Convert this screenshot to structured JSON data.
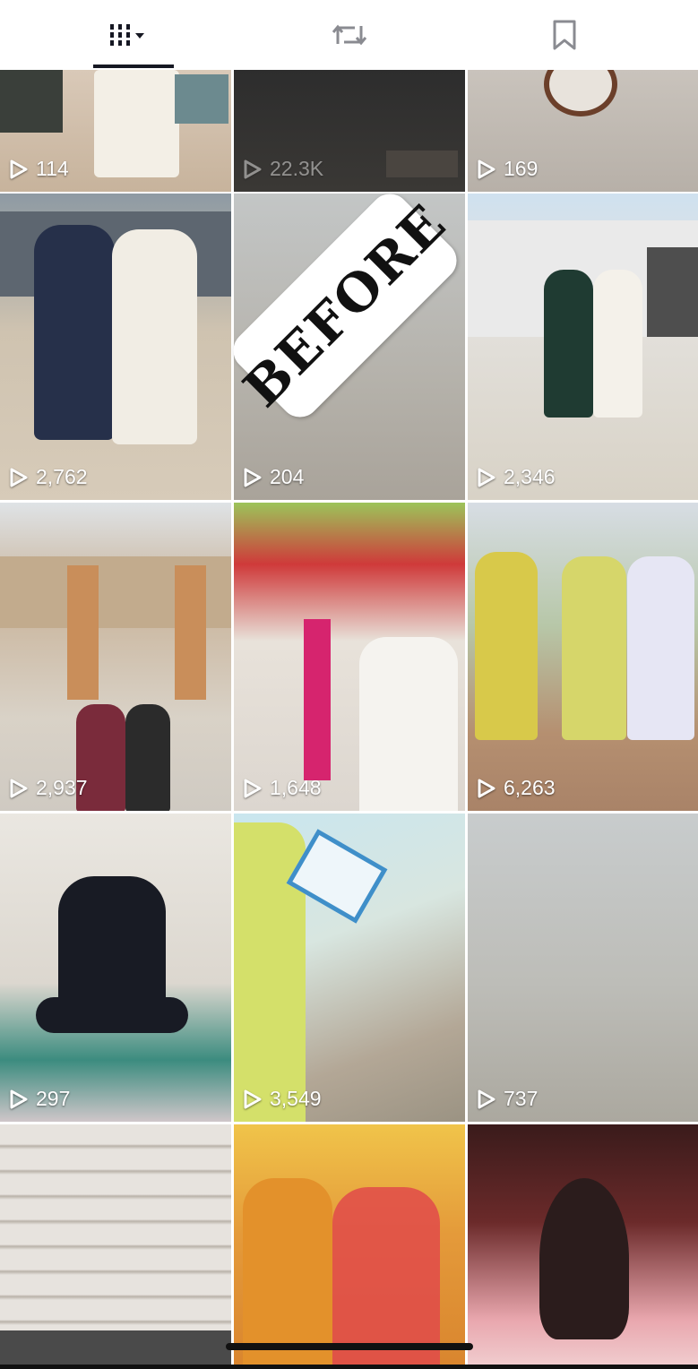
{
  "tabs": [
    {
      "name": "videos-grid-icon",
      "active": true
    },
    {
      "name": "repost-icon",
      "active": false
    },
    {
      "name": "bookmark-icon",
      "active": false
    }
  ],
  "sticker": {
    "text": "BEFORE"
  },
  "videos": [
    {
      "views": "114"
    },
    {
      "views": "22.3K"
    },
    {
      "views": "169"
    },
    {
      "views": "2,762"
    },
    {
      "views": "204"
    },
    {
      "views": "2,346"
    },
    {
      "views": "2,937"
    },
    {
      "views": "1,648"
    },
    {
      "views": "6,263"
    },
    {
      "views": "297"
    },
    {
      "views": "3,549"
    },
    {
      "views": "737"
    },
    {
      "views": ""
    },
    {
      "views": ""
    },
    {
      "views": ""
    }
  ],
  "colors": {
    "accent": "#161823",
    "overlay_text": "#ffffff"
  }
}
